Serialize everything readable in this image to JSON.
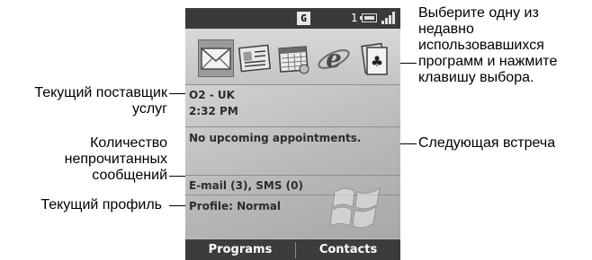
{
  "phone": {
    "status": {
      "network_icon_label": "G",
      "count": "1"
    },
    "apps": [
      {
        "icon": "envelope-icon",
        "selected": true
      },
      {
        "icon": "contacts-card-icon",
        "selected": false
      },
      {
        "icon": "calendar-icon",
        "selected": false
      },
      {
        "icon": "internet-explorer-icon",
        "selected": false
      },
      {
        "icon": "cards-game-icon",
        "selected": false
      }
    ],
    "operator": "O2 - UK",
    "time": "2:32 PM",
    "appointments": "No upcoming appointments.",
    "messages": "E-mail (3), SMS (0)",
    "profile": "Profile: Normal",
    "softkeys": {
      "left": "Programs",
      "right": "Contacts"
    }
  },
  "callouts": {
    "recent_apps": [
      "Выберите одну из",
      "недавно",
      "использовавшихся",
      "программ и нажмите",
      "клавишу выбора."
    ],
    "provider": [
      "Текущий поставщик",
      "услуг"
    ],
    "next_meeting": "Следующая встреча",
    "unread": [
      "Количество",
      "непрочитанных",
      "сообщений"
    ],
    "profile": "Текущий профиль"
  },
  "colors": {
    "status_bar": "#3a3a3a",
    "softkey_bar": "#3c3c3c",
    "screen_gray": "#bcbcbc"
  }
}
